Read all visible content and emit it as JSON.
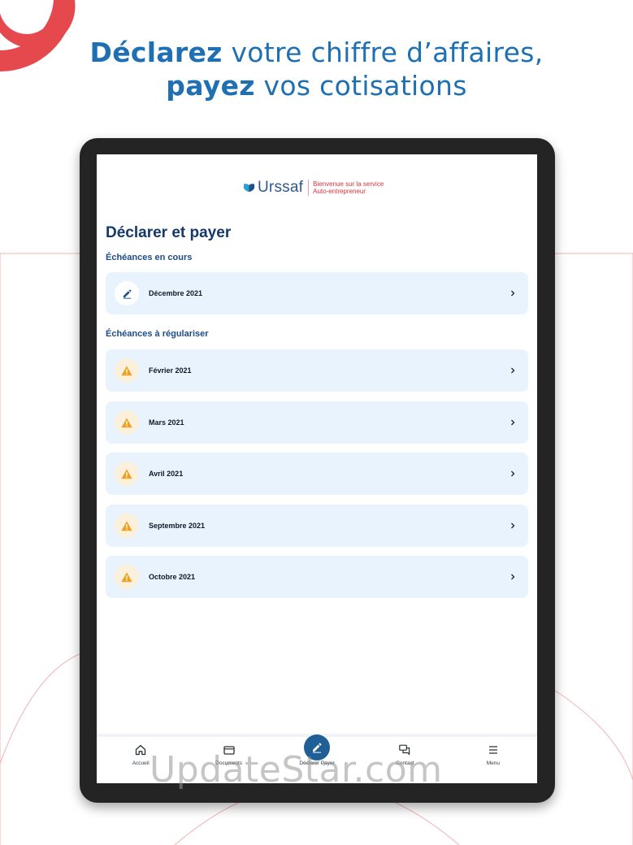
{
  "headline": {
    "line1_bold": "Déclarez",
    "line1_rest": " votre chiffre d’affaires,",
    "line2_bold": "payez",
    "line2_rest": " vos cotisations"
  },
  "app": {
    "logo_word": "Urssaf",
    "logo_tagline_1": "Bienvenue sur la service",
    "logo_tagline_2": "Auto-entrepreneur",
    "page_title": "Déclarer et payer",
    "current_section": "Échéances en cours",
    "current_items": [
      {
        "label": "Décembre 2021",
        "icon": "edit-icon"
      }
    ],
    "overdue_section": "Échéances à régulariser",
    "overdue_items": [
      {
        "label": "Février 2021",
        "icon": "warning-icon"
      },
      {
        "label": "Mars 2021",
        "icon": "warning-icon"
      },
      {
        "label": "Avril 2021",
        "icon": "warning-icon"
      },
      {
        "label": "Septembre 2021",
        "icon": "warning-icon"
      },
      {
        "label": "Octobre 2021",
        "icon": "warning-icon"
      }
    ],
    "tabs": [
      {
        "label": "Accueil",
        "icon": "home-icon"
      },
      {
        "label": "Documents",
        "icon": "folder-icon"
      },
      {
        "label": "Déclarer Payer",
        "icon": "edit-icon",
        "active": true
      },
      {
        "label": "Contact",
        "icon": "chat-icon"
      },
      {
        "label": "Menu",
        "icon": "menu-icon"
      }
    ]
  },
  "watermark": "UpdateStar.com",
  "colors": {
    "brand_blue": "#1f6fb3",
    "title_navy": "#14386a",
    "card_bg": "#e8f3fd",
    "warning": "#f0a020",
    "accent_red": "#e5484d",
    "fab_blue": "#1f5f96"
  }
}
